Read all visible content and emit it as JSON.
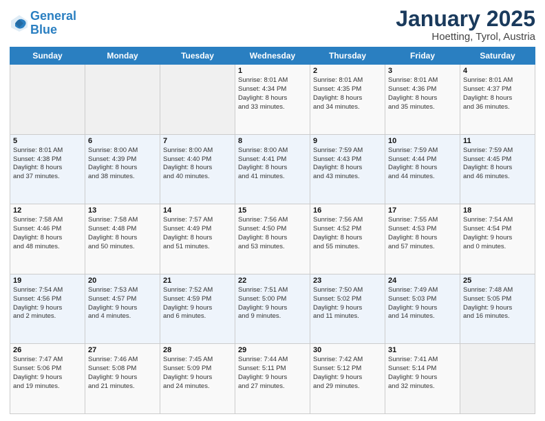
{
  "header": {
    "logo_line1": "General",
    "logo_line2": "Blue",
    "title": "January 2025",
    "subtitle": "Hoetting, Tyrol, Austria"
  },
  "weekdays": [
    "Sunday",
    "Monday",
    "Tuesday",
    "Wednesday",
    "Thursday",
    "Friday",
    "Saturday"
  ],
  "weeks": [
    [
      {
        "day": "",
        "info": ""
      },
      {
        "day": "",
        "info": ""
      },
      {
        "day": "",
        "info": ""
      },
      {
        "day": "1",
        "info": "Sunrise: 8:01 AM\nSunset: 4:34 PM\nDaylight: 8 hours\nand 33 minutes."
      },
      {
        "day": "2",
        "info": "Sunrise: 8:01 AM\nSunset: 4:35 PM\nDaylight: 8 hours\nand 34 minutes."
      },
      {
        "day": "3",
        "info": "Sunrise: 8:01 AM\nSunset: 4:36 PM\nDaylight: 8 hours\nand 35 minutes."
      },
      {
        "day": "4",
        "info": "Sunrise: 8:01 AM\nSunset: 4:37 PM\nDaylight: 8 hours\nand 36 minutes."
      }
    ],
    [
      {
        "day": "5",
        "info": "Sunrise: 8:01 AM\nSunset: 4:38 PM\nDaylight: 8 hours\nand 37 minutes."
      },
      {
        "day": "6",
        "info": "Sunrise: 8:00 AM\nSunset: 4:39 PM\nDaylight: 8 hours\nand 38 minutes."
      },
      {
        "day": "7",
        "info": "Sunrise: 8:00 AM\nSunset: 4:40 PM\nDaylight: 8 hours\nand 40 minutes."
      },
      {
        "day": "8",
        "info": "Sunrise: 8:00 AM\nSunset: 4:41 PM\nDaylight: 8 hours\nand 41 minutes."
      },
      {
        "day": "9",
        "info": "Sunrise: 7:59 AM\nSunset: 4:43 PM\nDaylight: 8 hours\nand 43 minutes."
      },
      {
        "day": "10",
        "info": "Sunrise: 7:59 AM\nSunset: 4:44 PM\nDaylight: 8 hours\nand 44 minutes."
      },
      {
        "day": "11",
        "info": "Sunrise: 7:59 AM\nSunset: 4:45 PM\nDaylight: 8 hours\nand 46 minutes."
      }
    ],
    [
      {
        "day": "12",
        "info": "Sunrise: 7:58 AM\nSunset: 4:46 PM\nDaylight: 8 hours\nand 48 minutes."
      },
      {
        "day": "13",
        "info": "Sunrise: 7:58 AM\nSunset: 4:48 PM\nDaylight: 8 hours\nand 50 minutes."
      },
      {
        "day": "14",
        "info": "Sunrise: 7:57 AM\nSunset: 4:49 PM\nDaylight: 8 hours\nand 51 minutes."
      },
      {
        "day": "15",
        "info": "Sunrise: 7:56 AM\nSunset: 4:50 PM\nDaylight: 8 hours\nand 53 minutes."
      },
      {
        "day": "16",
        "info": "Sunrise: 7:56 AM\nSunset: 4:52 PM\nDaylight: 8 hours\nand 55 minutes."
      },
      {
        "day": "17",
        "info": "Sunrise: 7:55 AM\nSunset: 4:53 PM\nDaylight: 8 hours\nand 57 minutes."
      },
      {
        "day": "18",
        "info": "Sunrise: 7:54 AM\nSunset: 4:54 PM\nDaylight: 9 hours\nand 0 minutes."
      }
    ],
    [
      {
        "day": "19",
        "info": "Sunrise: 7:54 AM\nSunset: 4:56 PM\nDaylight: 9 hours\nand 2 minutes."
      },
      {
        "day": "20",
        "info": "Sunrise: 7:53 AM\nSunset: 4:57 PM\nDaylight: 9 hours\nand 4 minutes."
      },
      {
        "day": "21",
        "info": "Sunrise: 7:52 AM\nSunset: 4:59 PM\nDaylight: 9 hours\nand 6 minutes."
      },
      {
        "day": "22",
        "info": "Sunrise: 7:51 AM\nSunset: 5:00 PM\nDaylight: 9 hours\nand 9 minutes."
      },
      {
        "day": "23",
        "info": "Sunrise: 7:50 AM\nSunset: 5:02 PM\nDaylight: 9 hours\nand 11 minutes."
      },
      {
        "day": "24",
        "info": "Sunrise: 7:49 AM\nSunset: 5:03 PM\nDaylight: 9 hours\nand 14 minutes."
      },
      {
        "day": "25",
        "info": "Sunrise: 7:48 AM\nSunset: 5:05 PM\nDaylight: 9 hours\nand 16 minutes."
      }
    ],
    [
      {
        "day": "26",
        "info": "Sunrise: 7:47 AM\nSunset: 5:06 PM\nDaylight: 9 hours\nand 19 minutes."
      },
      {
        "day": "27",
        "info": "Sunrise: 7:46 AM\nSunset: 5:08 PM\nDaylight: 9 hours\nand 21 minutes."
      },
      {
        "day": "28",
        "info": "Sunrise: 7:45 AM\nSunset: 5:09 PM\nDaylight: 9 hours\nand 24 minutes."
      },
      {
        "day": "29",
        "info": "Sunrise: 7:44 AM\nSunset: 5:11 PM\nDaylight: 9 hours\nand 27 minutes."
      },
      {
        "day": "30",
        "info": "Sunrise: 7:42 AM\nSunset: 5:12 PM\nDaylight: 9 hours\nand 29 minutes."
      },
      {
        "day": "31",
        "info": "Sunrise: 7:41 AM\nSunset: 5:14 PM\nDaylight: 9 hours\nand 32 minutes."
      },
      {
        "day": "",
        "info": ""
      }
    ]
  ]
}
